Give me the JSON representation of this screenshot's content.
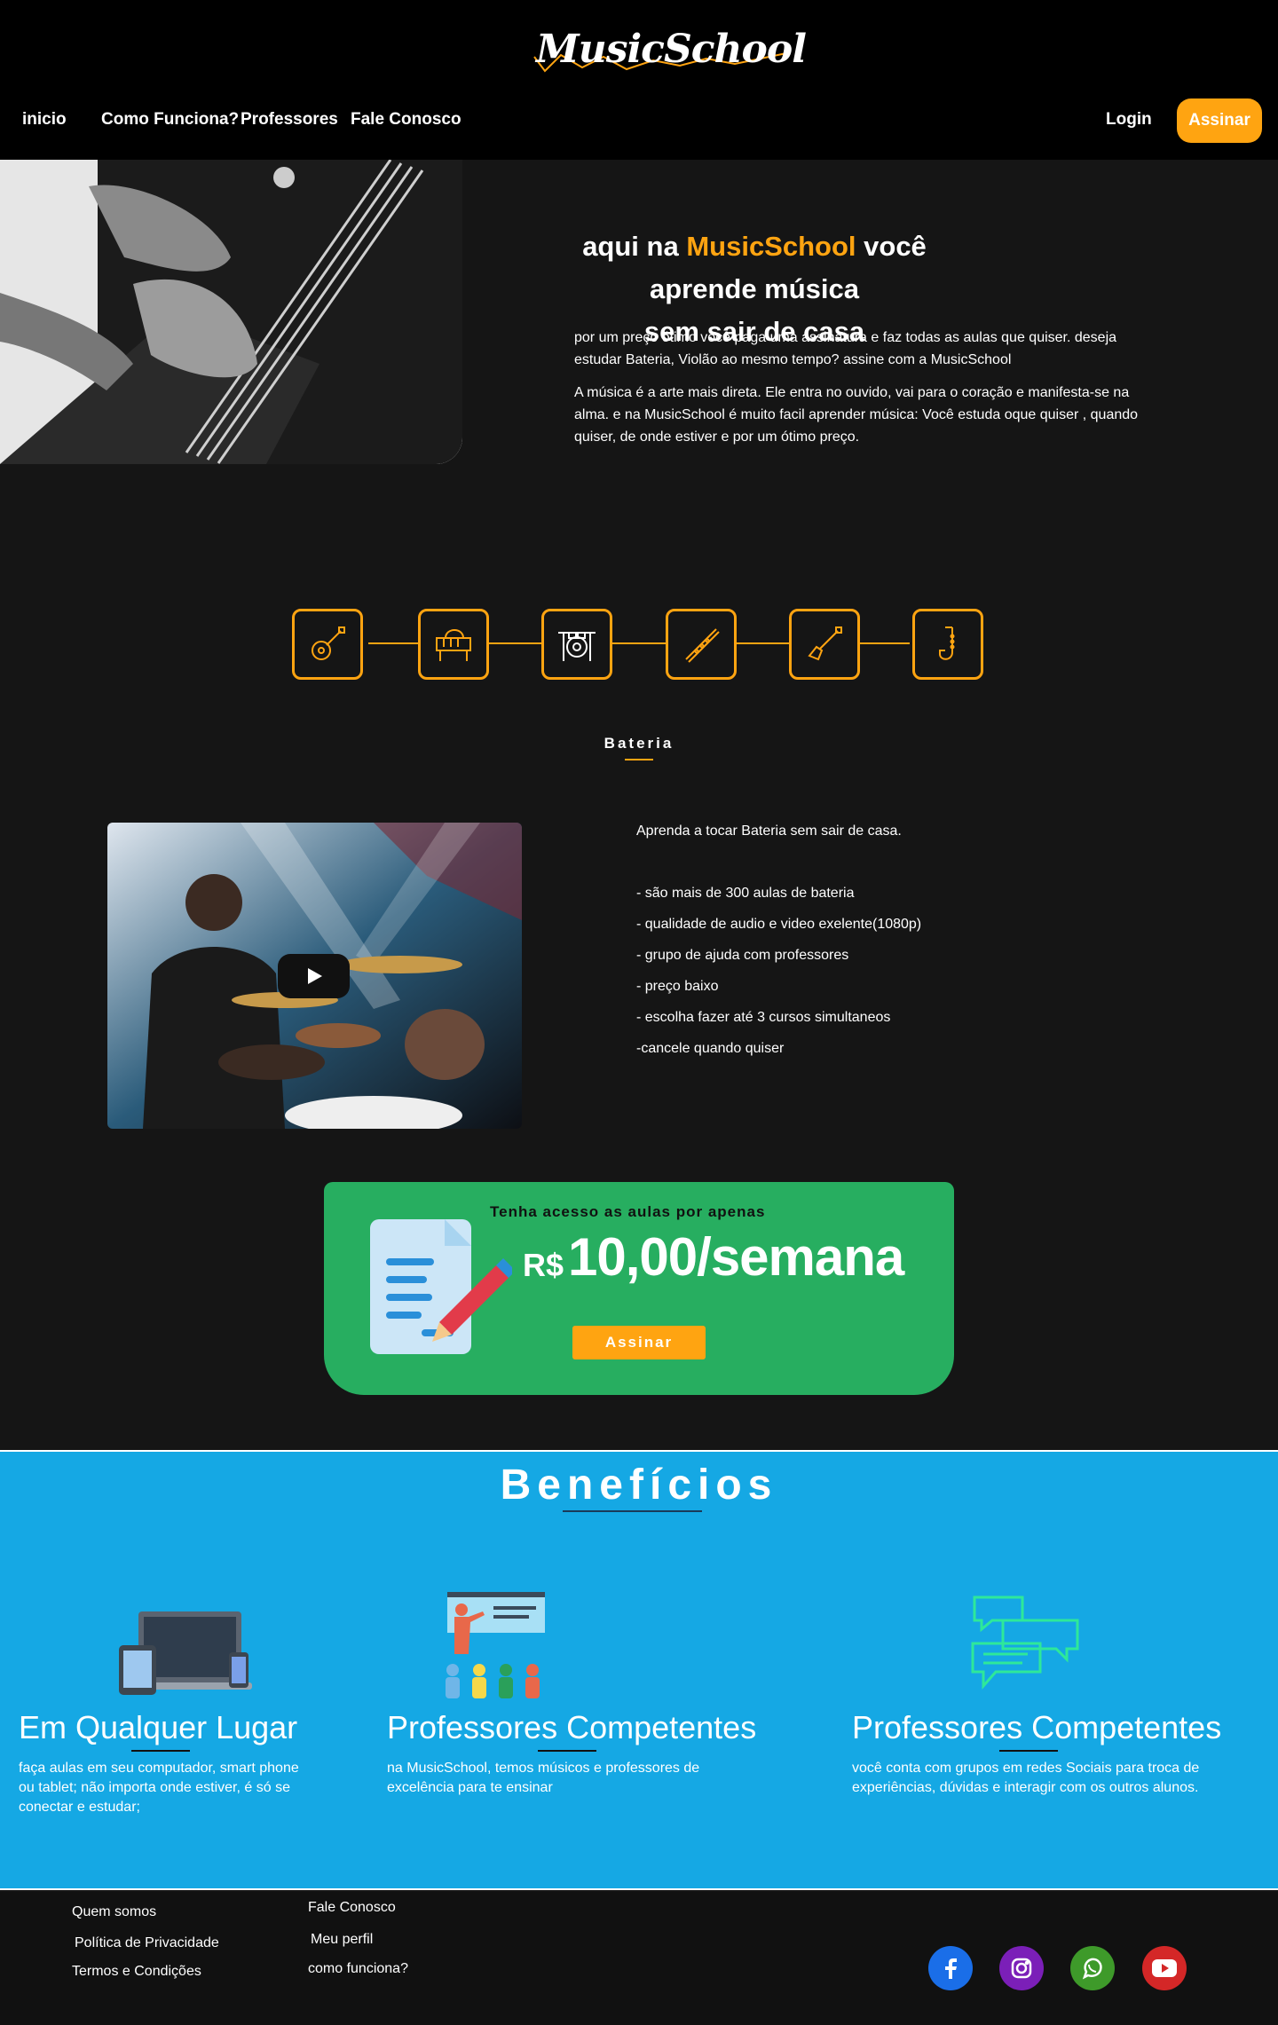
{
  "header": {
    "logo_text": "MusicSchool",
    "nav": [
      "inicio",
      "Como Funciona?",
      "Professores",
      "Fale Conosco"
    ],
    "login_label": "Login",
    "subscribe_label": "Assinar"
  },
  "hero": {
    "title_pre": "aqui na ",
    "title_brand": "MusicSchool",
    "title_post": " você aprende música",
    "title_line2": "sem sair de casa",
    "paragraph1": "por um preço ótimo você paga uma assinatura e faz todas as aulas que quiser.  deseja estudar Bateria, Violão ao mesmo tempo? assine com a MusicSchool",
    "paragraph2": "A música é a arte mais direta. Ele entra no ouvido, vai para o coração e manifesta-se na alma.  e na MusicSchool é muito facil aprender música: Você estuda oque quiser , quando quiser, de onde estiver e por um ótimo preço."
  },
  "instruments": {
    "items": [
      "guitar-acoustic",
      "piano",
      "drums",
      "flute",
      "electric-guitar",
      "saxophone"
    ],
    "selected_label": "Bateria"
  },
  "course": {
    "intro": "Aprenda  a tocar Bateria sem sair  de casa.",
    "items": [
      "- são mais de 300 aulas de bateria",
      "- qualidade de audio e video exelente(1080p)",
      "- grupo de ajuda com  professores",
      "- preço baixo",
      "- escolha fazer até 3 cursos simultaneos",
      "-cancele quando quiser"
    ]
  },
  "pricing": {
    "lead": "Tenha acesso as aulas por apenas",
    "currency": "R$",
    "value": "10,00/semana",
    "button": "Assinar"
  },
  "benefits": {
    "title": "Benefícios",
    "cards": [
      {
        "heading": "Em Qualquer Lugar",
        "text": "faça aulas em seu computador, smart phone ou tablet; não importa onde estiver, é só se conectar e estudar;"
      },
      {
        "heading": "Professores Competentes",
        "text": "na MusicSchool, temos músicos e professores de excelência para te ensinar"
      },
      {
        "heading": "Professores Competentes",
        "text": "você conta com grupos em redes Sociais para troca de experiências, dúvidas e interagir com os outros alunos."
      }
    ]
  },
  "footer": {
    "col1": [
      "Quem somos",
      "Política de Privacidade",
      "Termos e Condições"
    ],
    "col2": [
      "Fale Conosco",
      "Meu perfil",
      "como funciona?"
    ],
    "social": [
      "facebook-icon",
      "instagram-icon",
      "whatsapp-icon",
      "youtube-icon"
    ]
  },
  "colors": {
    "accent": "#ffa411",
    "price_bg": "#27ae60",
    "benefits_bg": "#15a8e4",
    "page_bg": "#151515"
  }
}
